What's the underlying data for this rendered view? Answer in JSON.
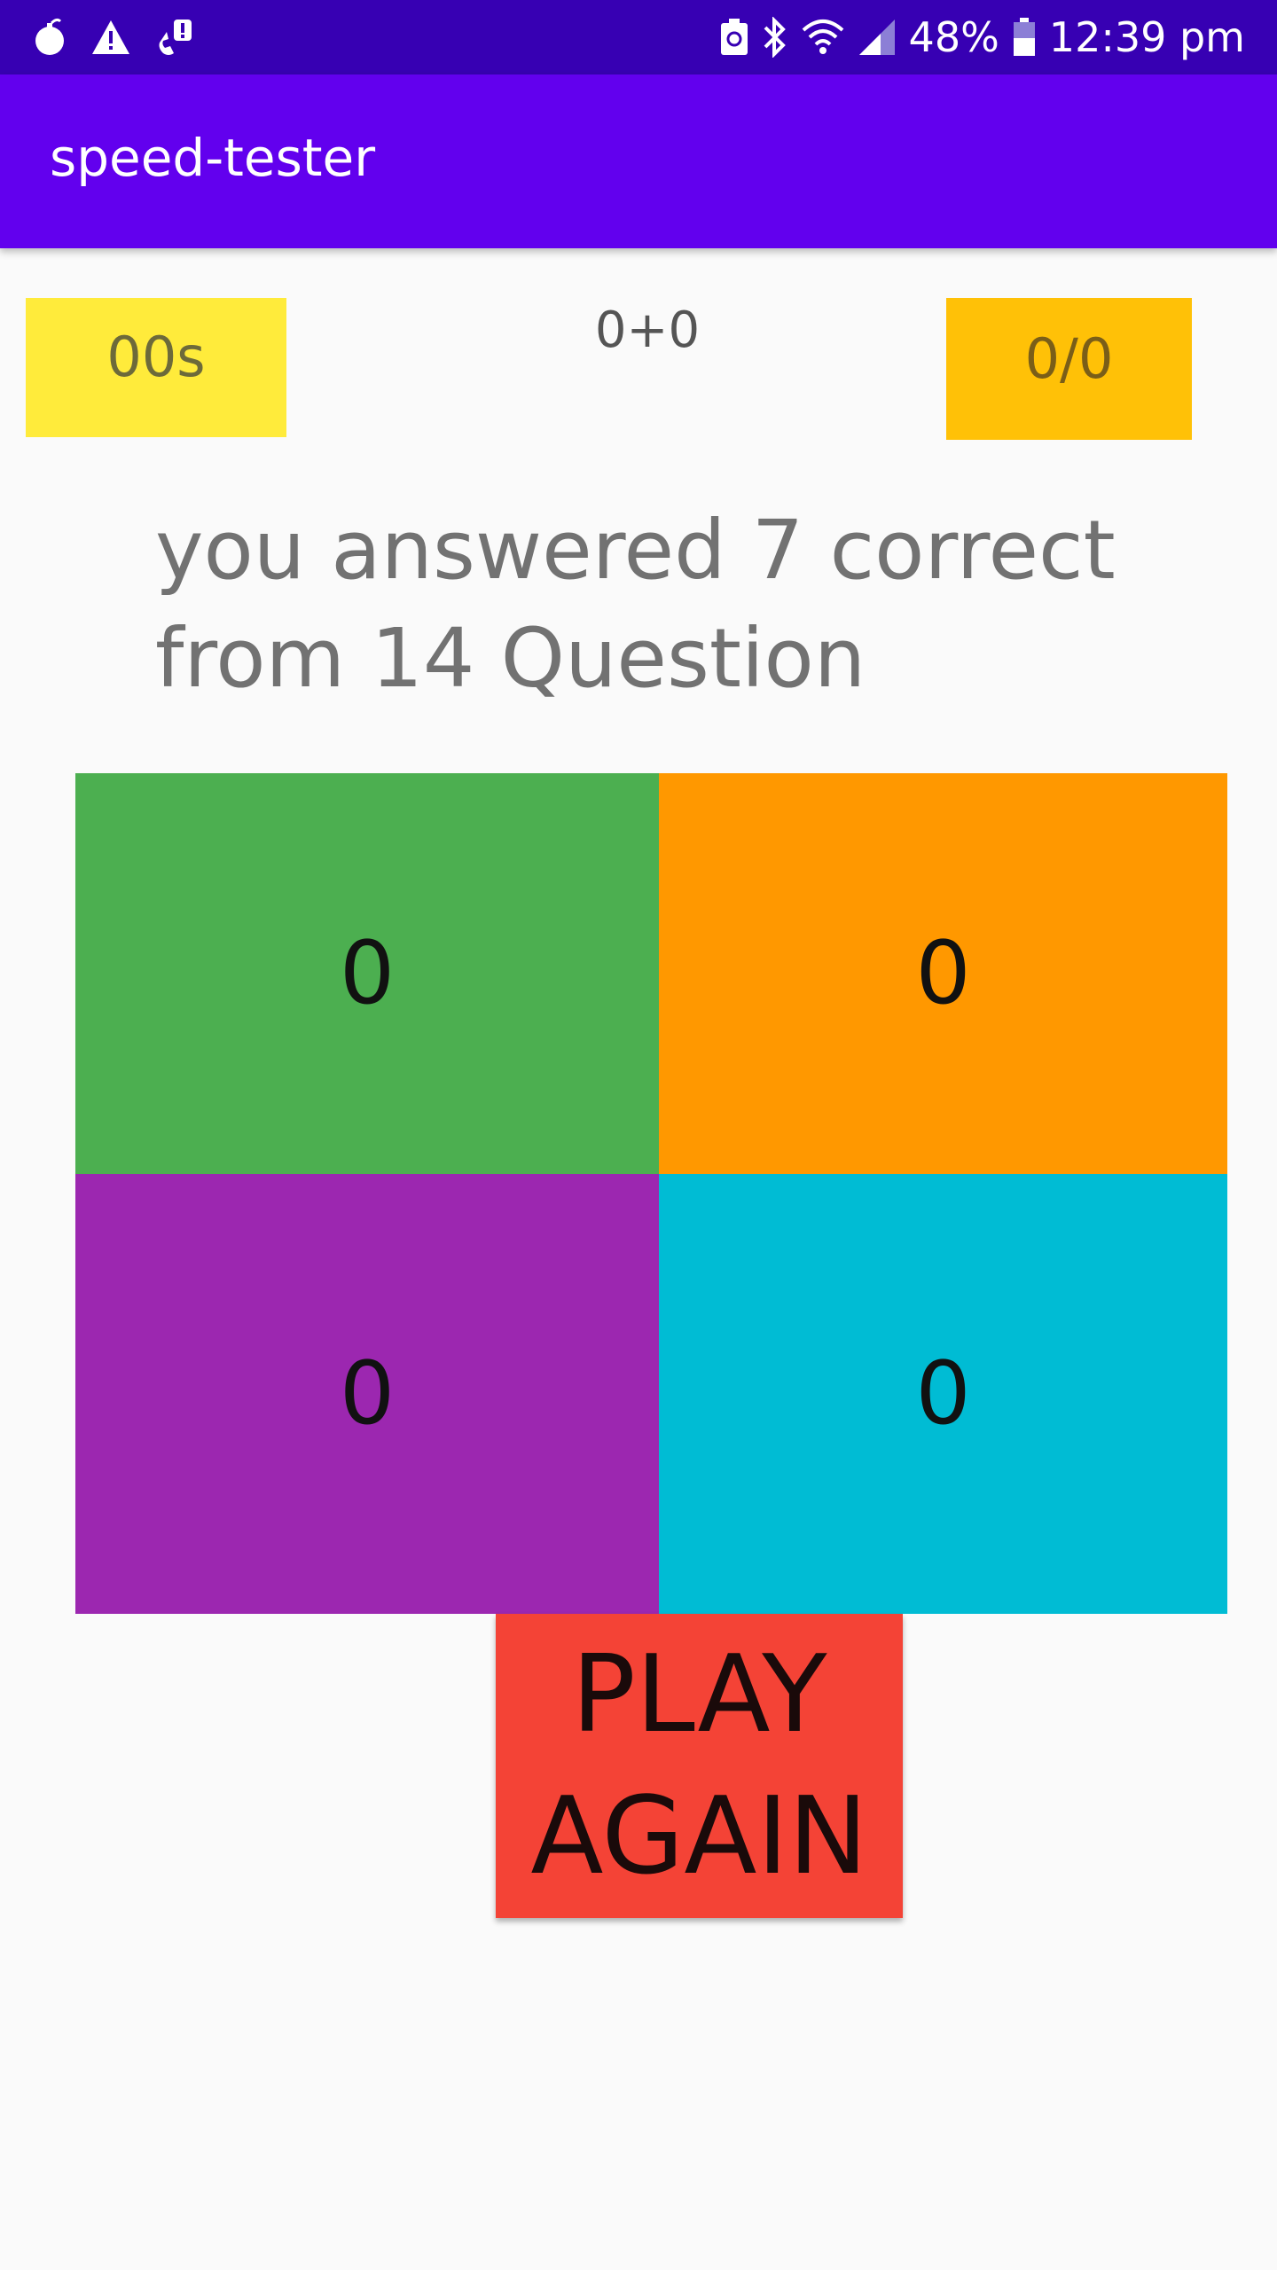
{
  "status_bar": {
    "battery_percent": "48%",
    "time": "12:39 pm",
    "left_icons": [
      "bomb-icon",
      "warning-icon",
      "call-alert-icon"
    ],
    "right_icons": [
      "battery-saver-icon",
      "bluetooth-icon",
      "wifi-icon",
      "signal-icon",
      "battery-icon"
    ]
  },
  "app_bar": {
    "title": "speed-tester"
  },
  "game": {
    "timer": "00s",
    "question": "0+0",
    "score": "0/0",
    "result_text": "you answered 7 correct from 14 Question",
    "answers": [
      "0",
      "0",
      "0",
      "0"
    ],
    "play_again_line1": "PLAY",
    "play_again_line2": "AGAIN"
  },
  "colors": {
    "status_bar": "#3700b3",
    "app_bar": "#6200ee",
    "timer_bg": "#ffeb3b",
    "score_bg": "#ffc107",
    "answer_green": "#4caf50",
    "answer_orange": "#ff9800",
    "answer_purple": "#9c27b0",
    "answer_cyan": "#00bcd4",
    "play_button": "#f44336"
  }
}
